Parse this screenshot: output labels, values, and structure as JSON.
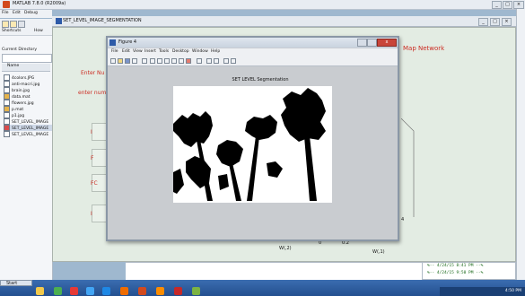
{
  "matlab": {
    "title": "MATLAB 7.8.0 (R2009a)",
    "menu": [
      "File",
      "Edit",
      "Debug"
    ],
    "shortcuts_label": "Shortcuts",
    "how_label": "How",
    "current_directory_label": "Current Directory",
    "name_header": "Name",
    "files": [
      "4colors.JPG",
      "anti-macri.jpg",
      "brain.jpg",
      "data.mat",
      "flowers.jpg",
      "p.mat",
      "p1.jpg",
      "SET_LEVEL_IMAGE",
      "SET_LEVEL_IMAGE",
      "SET_LEVEL_IMAGE"
    ],
    "selected_file_index": 8
  },
  "gui": {
    "title": "SET_LEVEL_IMAGE_SEGMENTATION",
    "heading_right": "Map Network",
    "label_enter_1": "Enter Nu",
    "label_enter_2": "enter num",
    "buttons": [
      "I",
      "F",
      "FC",
      "I"
    ],
    "axis_label_w2": "W(,2)",
    "axis_label_w1": "W(,1)",
    "tick_0": "0",
    "tick_02": "0.2",
    "tick_4": "4"
  },
  "history": [
    "%-- 4/24/15  8:41 PM --%",
    "%-- 4/24/15  9:50 PM --%"
  ],
  "figure4": {
    "title": "Figure 4",
    "menu": [
      "File",
      "Edit",
      "View",
      "Insert",
      "Tools",
      "Desktop",
      "Window",
      "Help"
    ],
    "plot_title": "SET LEVEL Segmentation",
    "close_label": "x"
  },
  "taskbar": {
    "start_label": "Start",
    "clock": "4:50 PM"
  },
  "colors": {
    "accent_red": "#cc2b22",
    "taskbar_blue": "#234f8f",
    "matlab_orange": "#d24a1e"
  }
}
